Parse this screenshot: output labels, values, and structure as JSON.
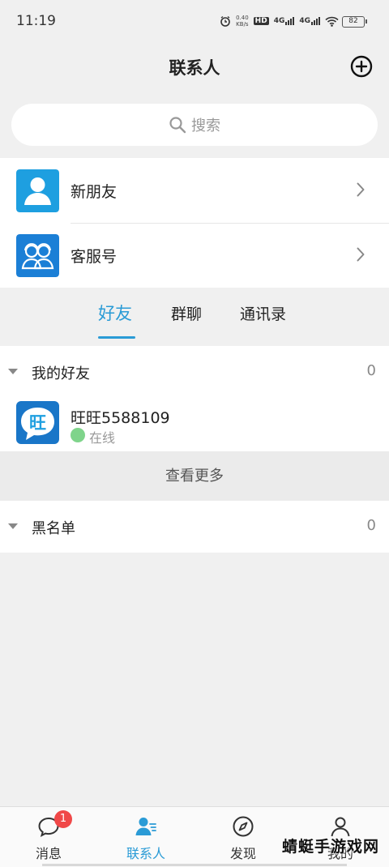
{
  "status_bar": {
    "time": "11:19",
    "net_speed_value": "0.40",
    "net_speed_unit": "KB/s",
    "hd_label": "HD",
    "sim1_label": "4G",
    "sim2_label": "4G",
    "battery": "82"
  },
  "header": {
    "title": "联系人"
  },
  "search": {
    "placeholder": "搜索"
  },
  "list": {
    "new_friends": "新朋友",
    "customer_service": "客服号"
  },
  "tabs": {
    "items": [
      "好友",
      "群聊",
      "通讯录"
    ],
    "active": 0
  },
  "friends_group": {
    "label": "我的好友",
    "count": "0"
  },
  "friend": {
    "name": "旺旺5588109",
    "status": "在线",
    "avatar_glyph": "旺"
  },
  "see_more": "查看更多",
  "blacklist": {
    "label": "黑名单",
    "count": "0"
  },
  "bottom_nav": {
    "items": [
      "消息",
      "联系人",
      "发现",
      "我的"
    ],
    "active": 1,
    "message_badge": "1"
  },
  "watermark": "蜻蜓手游戏网",
  "colors": {
    "accent": "#2a9bd6",
    "avatar_blue": "#1e9fe0",
    "service_blue": "#1b7fd6",
    "badge_red": "#f04848",
    "online_green": "#7fd48b"
  }
}
